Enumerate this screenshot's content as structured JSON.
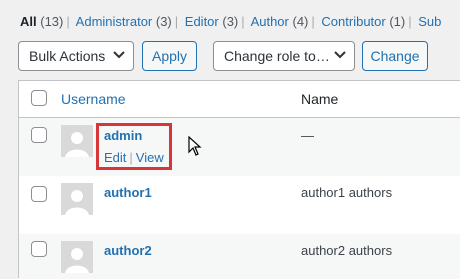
{
  "filters": [
    {
      "label": "All",
      "count": "(13)",
      "current": true
    },
    {
      "label": "Administrator",
      "count": "(3)",
      "current": false
    },
    {
      "label": "Editor",
      "count": "(3)",
      "current": false
    },
    {
      "label": "Author",
      "count": "(4)",
      "current": false
    },
    {
      "label": "Contributor",
      "count": "(1)",
      "current": false
    },
    {
      "label": "Sub",
      "count": "",
      "current": false
    }
  ],
  "toolbar": {
    "bulk_actions": "Bulk Actions",
    "apply": "Apply",
    "change_role": "Change role to…",
    "change": "Change"
  },
  "table": {
    "headers": {
      "username": "Username",
      "name": "Name"
    },
    "rows": [
      {
        "username": "admin",
        "name": "—",
        "actions": {
          "edit": "Edit",
          "view": "View"
        }
      },
      {
        "username": "author1",
        "name": "author1 authors"
      },
      {
        "username": "author2",
        "name": "author2 authors"
      }
    ]
  },
  "colors": {
    "link": "#2271b1",
    "highlight": "#d63638"
  }
}
